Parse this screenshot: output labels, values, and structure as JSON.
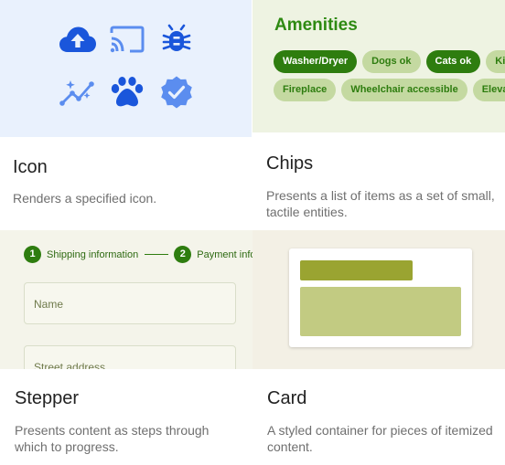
{
  "tiles": {
    "icon": {
      "title": "Icon",
      "description": "Renders a specified icon.",
      "icons": [
        "cloud-upload-icon",
        "cast-icon",
        "bug-icon",
        "insights-icon",
        "paw-icon",
        "verified-badge-icon"
      ],
      "colors": {
        "background": "#e9f1fd",
        "primary": "#1a56db",
        "secondary": "#5b8def"
      }
    },
    "chips": {
      "title": "Chips",
      "description": "Presents a list of items as a set of small, tactile entities.",
      "heading": "Amenities",
      "chips_row1": [
        {
          "label": "Washer/Dryer",
          "selected": true
        },
        {
          "label": "Dogs ok",
          "selected": false
        },
        {
          "label": "Cats ok",
          "selected": true
        },
        {
          "label": "Kitchen",
          "selected": false
        }
      ],
      "chips_row2": [
        {
          "label": "Fireplace",
          "selected": false
        },
        {
          "label": "Wheelchair accessible",
          "selected": false
        },
        {
          "label": "Elevator",
          "selected": false
        }
      ],
      "colors": {
        "background": "#eef3e2",
        "selected": "#2e7d0f",
        "unselected": "#c4d9a1"
      }
    },
    "stepper": {
      "title": "Stepper",
      "description": "Presents content as steps through which to progress.",
      "steps": [
        {
          "number": "1",
          "label": "Shipping information"
        },
        {
          "number": "2",
          "label": "Payment information"
        }
      ],
      "fields": {
        "name_placeholder": "Name",
        "street_placeholder": "Street address"
      },
      "colors": {
        "background": "#f4f4ea",
        "accent": "#2e7d0f"
      }
    },
    "card": {
      "title": "Card",
      "description": "A styled container for pieces of itemized content.",
      "colors": {
        "background": "#f3f0e5",
        "header": "#9aa431",
        "body": "#c2cb82"
      }
    }
  }
}
